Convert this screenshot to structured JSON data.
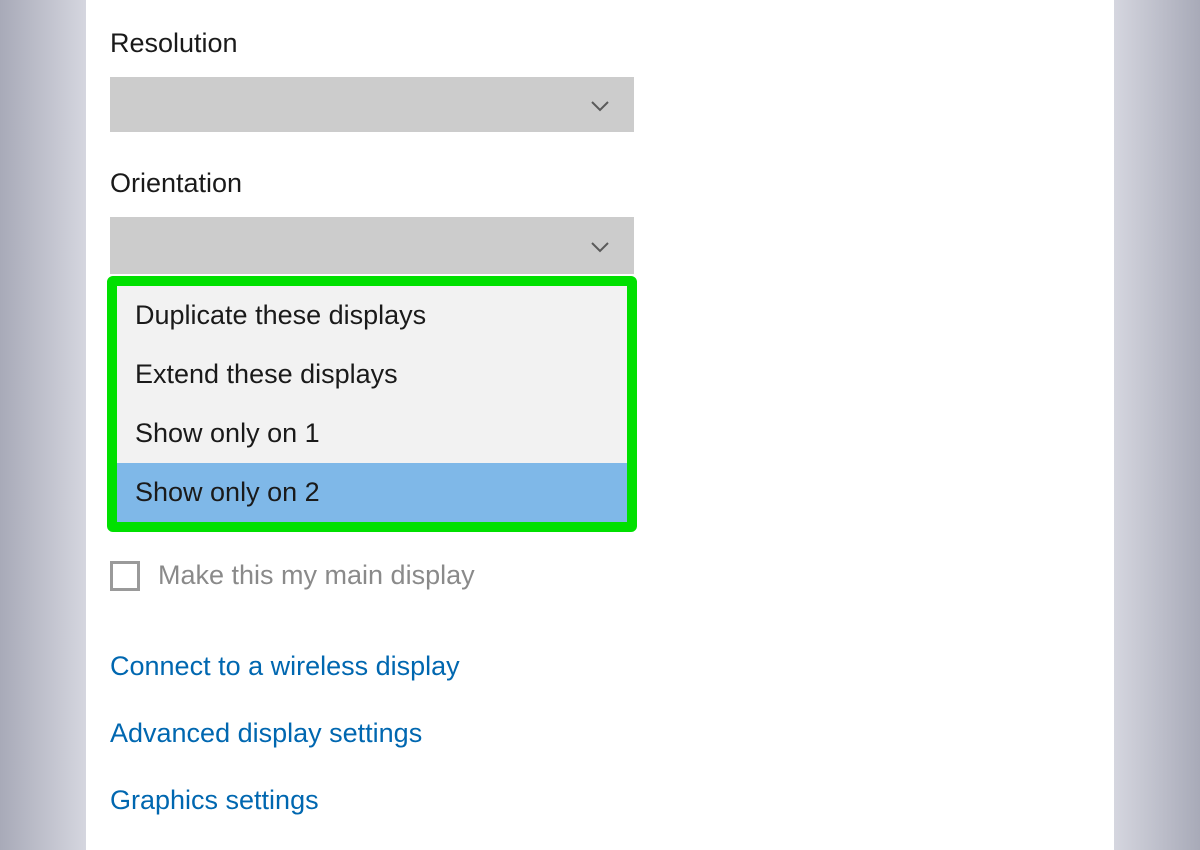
{
  "labels": {
    "resolution": "Resolution",
    "orientation": "Orientation"
  },
  "resolution_dropdown": {
    "value": ""
  },
  "orientation_dropdown": {
    "value": ""
  },
  "multiple_displays_options": [
    "Duplicate these displays",
    "Extend these displays",
    "Show only on 1",
    "Show only on 2"
  ],
  "checkbox": {
    "label": "Make this my main display"
  },
  "links": [
    "Connect to a wireless display",
    "Advanced display settings",
    "Graphics settings"
  ]
}
